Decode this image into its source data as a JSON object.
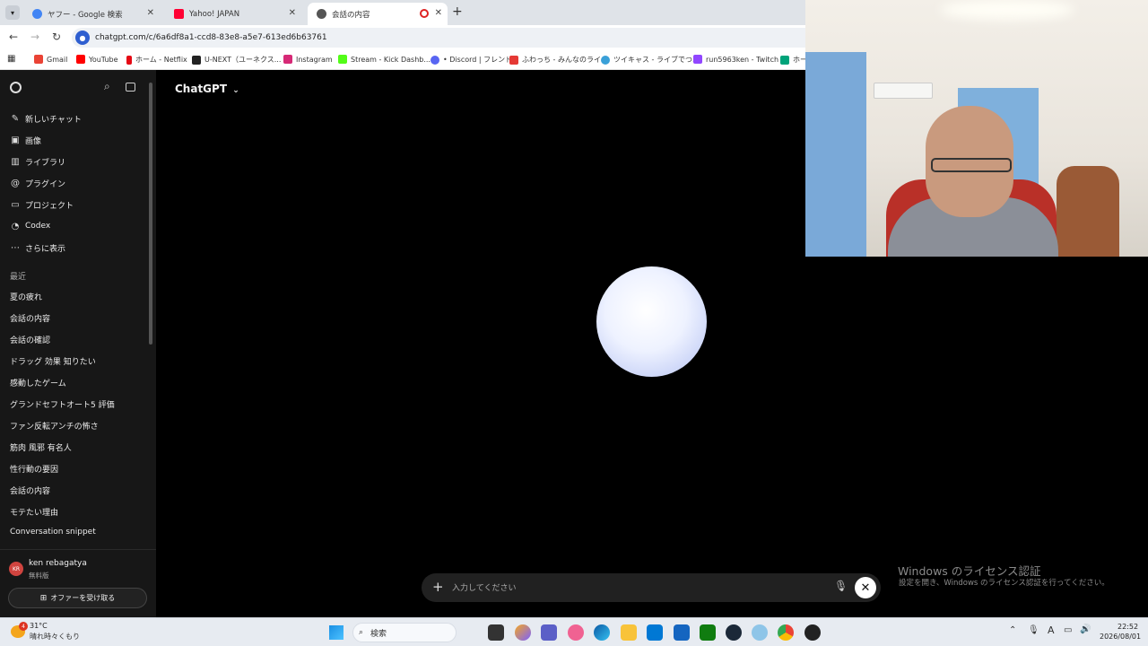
{
  "browser": {
    "tabs": [
      {
        "label": "ヤフー - Google 検索",
        "icon_color": "#4285f4"
      },
      {
        "label": "Yahoo! JAPAN",
        "icon_color": "#ff0033"
      },
      {
        "label": "会話の内容",
        "icon_color": "#444444"
      }
    ],
    "url": "chatgpt.com/c/6a6df8a1-ccd8-83e8-a5e7-613ed6b63761",
    "bookmarks": [
      {
        "label": "Gmail",
        "color": "#ea4335"
      },
      {
        "label": "YouTube",
        "color": "#ff0000"
      },
      {
        "label": "ホーム - Netflix",
        "color": "#e50914"
      },
      {
        "label": "U-NEXT（ユーネクス...",
        "color": "#222222"
      },
      {
        "label": "Instagram",
        "color": "#d62976"
      },
      {
        "label": "Stream - Kick Dashb...",
        "color": "#53fc18"
      },
      {
        "label": "• Discord | フレンド",
        "color": "#5865f2"
      },
      {
        "label": "ふわっち - みんなのライ...",
        "color": "#e53935"
      },
      {
        "label": "ツイキャス - ライブでつ...",
        "color": "#3aa0d8"
      },
      {
        "label": "run5963ken - Twitch",
        "color": "#9146ff"
      },
      {
        "label": "ホー...",
        "color": "#00a37a"
      }
    ]
  },
  "sidebar": {
    "nav": [
      {
        "label": "新しいチャット",
        "icon": "✎"
      },
      {
        "label": "画像",
        "icon": "▣"
      },
      {
        "label": "ライブラリ",
        "icon": "▥"
      },
      {
        "label": "プラグイン",
        "icon": "@"
      },
      {
        "label": "プロジェクト",
        "icon": "▭"
      },
      {
        "label": "Codex",
        "icon": "◔"
      },
      {
        "label": "さらに表示",
        "icon": "⋯"
      }
    ],
    "recent_header": "最近",
    "recent": [
      "夏の疲れ",
      "会話の内容",
      "会話の確認",
      "ドラッグ 効果 知りたい",
      "感動したゲーム",
      "グランドセフトオート5 評価",
      "ファン反転アンチの怖さ",
      "筋肉 風邪 有名人",
      "性行動の要因",
      "会話の内容",
      "モテたい理由",
      "Conversation snippet"
    ],
    "user": {
      "name": "ken rebagatya",
      "plan": "無料版",
      "initials": "KR"
    },
    "offer_button": "オファーを受け取る"
  },
  "main": {
    "model_title": "ChatGPT",
    "composer_placeholder": "入力してください"
  },
  "overlay": {
    "activation_title": "Windows のライセンス認証",
    "activation_sub": "設定を開き、Windows のライセンス認証を行ってください。"
  },
  "taskbar": {
    "weather_temp": "31°C",
    "weather_desc": "晴れ時々くもり",
    "weather_badge": "4",
    "search_label": "検索",
    "time": "22:52",
    "date": "2026/08/01"
  }
}
